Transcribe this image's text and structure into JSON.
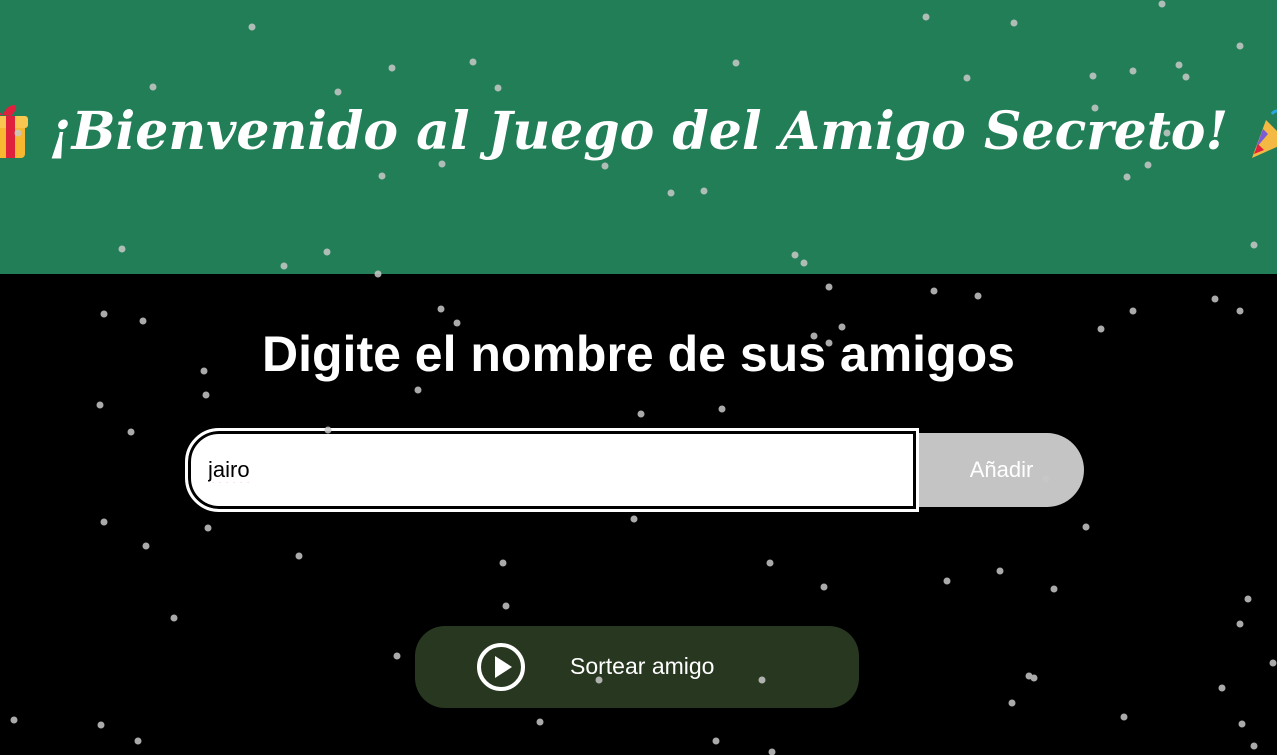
{
  "header": {
    "title": "¡Bienvenido al Juego del Amigo Secreto!",
    "left_icon": "gift-icon",
    "right_icon": "party-popper-icon",
    "background_color": "#217e56"
  },
  "main": {
    "subtitle": "Digite el nombre de sus amigos",
    "name_input": {
      "value": "jairo"
    },
    "add_button_label": "Añadir",
    "draw_button": {
      "label": "Sortear amigo",
      "icon": "play-circle-icon",
      "background_color": "#283820"
    }
  },
  "colors": {
    "page_background": "#000000",
    "add_button": "#c4c4c4",
    "snow": "#c8c8c8"
  }
}
